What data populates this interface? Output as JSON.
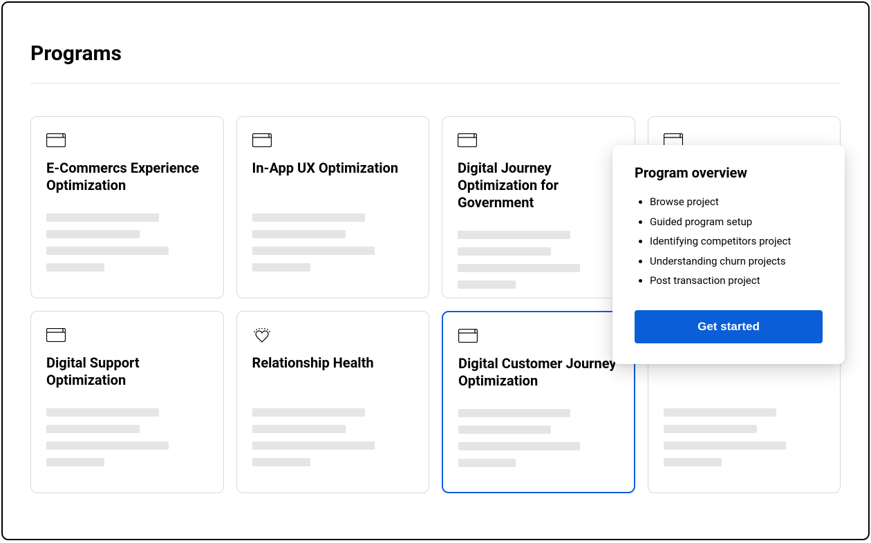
{
  "page": {
    "title": "Programs"
  },
  "cards": [
    {
      "title": "E-Commercs Experience Optimization",
      "icon": "window"
    },
    {
      "title": "In-App UX Optimization",
      "icon": "window"
    },
    {
      "title": "Digital Journey Optimization for Government",
      "icon": "window"
    },
    {
      "title": "",
      "icon": "window"
    },
    {
      "title": "Digital Support Optimization",
      "icon": "window"
    },
    {
      "title": "Relationship Health",
      "icon": "heart"
    },
    {
      "title": "Digital Customer Journey Optimization",
      "icon": "window",
      "selected": true
    },
    {
      "title": "",
      "icon": "window"
    }
  ],
  "popover": {
    "title": "Program overview",
    "items": [
      "Browse project",
      "Guided program setup",
      "Identifying competitors project",
      "Understanding churn projects",
      "Post transaction project"
    ],
    "cta": "Get started"
  },
  "colors": {
    "accent": "#0a5ed7",
    "skeleton": "#e5e5e5",
    "border": "#d9d9d9"
  }
}
